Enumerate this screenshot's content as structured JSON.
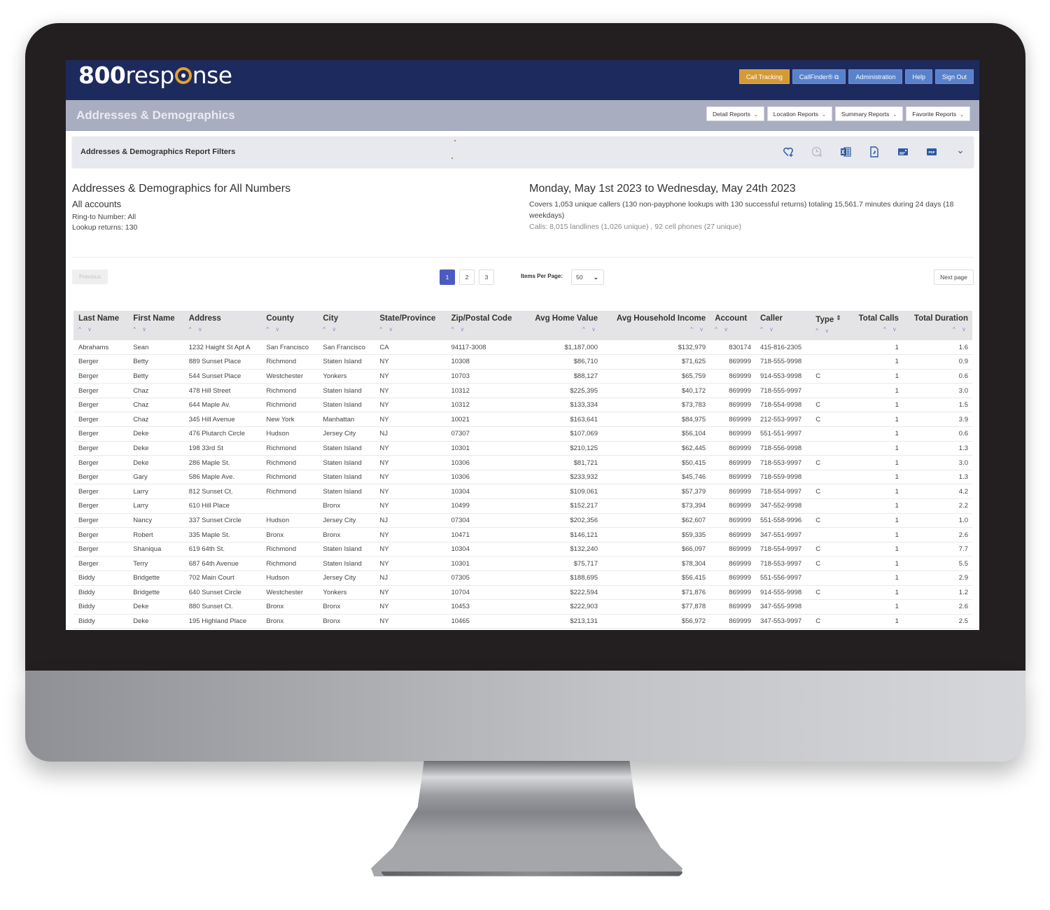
{
  "app": {
    "logo": {
      "bold": "800",
      "light_before": "resp",
      "light_after": "nse"
    },
    "top_nav": [
      {
        "label": "Call Tracking",
        "active": true
      },
      {
        "label": "CallFinder® ⧉",
        "active": false
      },
      {
        "label": "Administration",
        "active": false
      },
      {
        "label": "Help",
        "active": false
      },
      {
        "label": "Sign Out",
        "active": false
      }
    ]
  },
  "subheader": {
    "title": "Addresses & Demographics",
    "menus": [
      "Detail Reports",
      "Location Reports",
      "Summary Reports",
      "Favorite Reports"
    ]
  },
  "filters": {
    "title": "Addresses & Demographics Report Filters",
    "icons": [
      "heart-plus-icon",
      "clock-x-icon",
      "excel-export-icon",
      "csv-export-icon",
      "email-report-icon",
      "pdf-export-icon",
      "chevron-down-icon"
    ]
  },
  "summary": {
    "left": {
      "heading": "Addresses & Demographics for All Numbers",
      "accounts": "All accounts",
      "ring_to": "Ring-to Number: All",
      "lookup": "Lookup returns: 130"
    },
    "right": {
      "date_range": "Monday, May 1st 2023 to Wednesday, May 24th 2023",
      "coverage": "Covers 1,053 unique callers (130 non-payphone lookups with 130 successful returns) totaling 15,561.7 minutes during 24 days (18 weekdays)",
      "calls": "Calls: 8,015 landlines (1,026 unique) , 92 cell phones (27 unique)"
    }
  },
  "pagination": {
    "previous": "Previous",
    "pages": [
      "1",
      "2",
      "3"
    ],
    "current_page": "1",
    "items_per_page_label": "Items Per Page:",
    "items_per_page": "50",
    "next": "Next page"
  },
  "table": {
    "columns": [
      {
        "label": "Last Name",
        "align": "left"
      },
      {
        "label": "First Name",
        "align": "left"
      },
      {
        "label": "Address",
        "align": "left"
      },
      {
        "label": "County",
        "align": "left"
      },
      {
        "label": "City",
        "align": "left"
      },
      {
        "label": "State/Province",
        "align": "left"
      },
      {
        "label": "Zip/Postal Code",
        "align": "left"
      },
      {
        "label": "Avg Home Value",
        "align": "right"
      },
      {
        "label": "Avg Household Income",
        "align": "right"
      },
      {
        "label": "Account",
        "align": "left"
      },
      {
        "label": "Caller",
        "align": "left"
      },
      {
        "label": "Type",
        "align": "left"
      },
      {
        "label": "Total Calls",
        "align": "right"
      },
      {
        "label": "Total Duration",
        "align": "right"
      }
    ],
    "sort_glyph": "^ v",
    "type_sort_glyph": "⇕",
    "rows": [
      [
        "Abrahams",
        "Sean",
        "1232 Haight St Apt A",
        "San Francisco",
        "San Francisco",
        "CA",
        "94117-3008",
        "$1,187,000",
        "$132,979",
        "830174",
        "415-816-2305",
        "",
        "1",
        "1.6"
      ],
      [
        "Berger",
        "Betty",
        "889 Sunset Place",
        "Richmond",
        "Staten Island",
        "NY",
        "10308",
        "$86,710",
        "$71,625",
        "869999",
        "718-555-9998",
        "",
        "1",
        "0.9"
      ],
      [
        "Berger",
        "Betty",
        "544 Sunset Place",
        "Westchester",
        "Yonkers",
        "NY",
        "10703",
        "$88,127",
        "$65,759",
        "869999",
        "914-553-9998",
        "C",
        "1",
        "0.6"
      ],
      [
        "Berger",
        "Chaz",
        "478 Hill Street",
        "Richmond",
        "Staten Island",
        "NY",
        "10312",
        "$225,395",
        "$40,172",
        "869999",
        "718-555-9997",
        "",
        "1",
        "3.0"
      ],
      [
        "Berger",
        "Chaz",
        "644 Maple Av.",
        "Richmond",
        "Staten Island",
        "NY",
        "10312",
        "$133,334",
        "$73,783",
        "869999",
        "718-554-9998",
        "C",
        "1",
        "1.5"
      ],
      [
        "Berger",
        "Chaz",
        "345 Hill Avenue",
        "New York",
        "Manhattan",
        "NY",
        "10021",
        "$163,641",
        "$84,975",
        "869999",
        "212-553-9997",
        "C",
        "1",
        "3.9"
      ],
      [
        "Berger",
        "Deke",
        "476 Plutarch Circle",
        "Hudson",
        "Jersey City",
        "NJ",
        "07307",
        "$107,069",
        "$56,104",
        "869999",
        "551-551-9997",
        "",
        "1",
        "0.6"
      ],
      [
        "Berger",
        "Deke",
        "198 33rd St",
        "Richmond",
        "Staten Island",
        "NY",
        "10301",
        "$210,125",
        "$62,445",
        "869999",
        "718-556-9998",
        "",
        "1",
        "1.3"
      ],
      [
        "Berger",
        "Deke",
        "286 Maple St.",
        "Richmond",
        "Staten Island",
        "NY",
        "10306",
        "$81,721",
        "$50,415",
        "869999",
        "718-553-9997",
        "C",
        "1",
        "3.0"
      ],
      [
        "Berger",
        "Gary",
        "586 Maple Ave.",
        "Richmond",
        "Staten Island",
        "NY",
        "10306",
        "$233,932",
        "$45,746",
        "869999",
        "718-559-9998",
        "",
        "1",
        "1.3"
      ],
      [
        "Berger",
        "Larry",
        "812 Sunset Ct.",
        "Richmond",
        "Staten Island",
        "NY",
        "10304",
        "$109,061",
        "$57,379",
        "869999",
        "718-554-9997",
        "C",
        "1",
        "4.2"
      ],
      [
        "Berger",
        "Larry",
        "610 Hill Place",
        "",
        "Bronx",
        "NY",
        "10499",
        "$152,217",
        "$73,394",
        "869999",
        "347-552-9998",
        "",
        "1",
        "2.2"
      ],
      [
        "Berger",
        "Nancy",
        "337 Sunset Circle",
        "Hudson",
        "Jersey City",
        "NJ",
        "07304",
        "$202,356",
        "$62,607",
        "869999",
        "551-558-9996",
        "C",
        "1",
        "1.0"
      ],
      [
        "Berger",
        "Robert",
        "335 Maple St.",
        "Bronx",
        "Bronx",
        "NY",
        "10471",
        "$146,121",
        "$59,335",
        "869999",
        "347-551-9997",
        "",
        "1",
        "2.6"
      ],
      [
        "Berger",
        "Shaniqua",
        "619 64th St.",
        "Richmond",
        "Staten Island",
        "NY",
        "10304",
        "$132,240",
        "$66,097",
        "869999",
        "718-554-9997",
        "C",
        "1",
        "7.7"
      ],
      [
        "Berger",
        "Terry",
        "687 64th Avenue",
        "Richmond",
        "Staten Island",
        "NY",
        "10301",
        "$75,717",
        "$78,304",
        "869999",
        "718-553-9997",
        "C",
        "1",
        "5.5"
      ],
      [
        "Biddy",
        "Bridgette",
        "702 Main Court",
        "Hudson",
        "Jersey City",
        "NJ",
        "07305",
        "$188,695",
        "$56,415",
        "869999",
        "551-556-9997",
        "",
        "1",
        "2.9"
      ],
      [
        "Biddy",
        "Bridgette",
        "640 Sunset Circle",
        "Westchester",
        "Yonkers",
        "NY",
        "10704",
        "$222,594",
        "$71,876",
        "869999",
        "914-555-9998",
        "C",
        "1",
        "1.2"
      ],
      [
        "Biddy",
        "Deke",
        "880 Sunset Ct.",
        "Bronx",
        "Bronx",
        "NY",
        "10453",
        "$222,903",
        "$77,878",
        "869999",
        "347-555-9998",
        "",
        "1",
        "2.6"
      ],
      [
        "Biddy",
        "Deke",
        "195 Highland Place",
        "Bronx",
        "Bronx",
        "NY",
        "10465",
        "$213,131",
        "$56,972",
        "869999",
        "347-553-9997",
        "C",
        "1",
        "2.5"
      ]
    ]
  },
  "colors": {
    "topbar": "#1d2a5e",
    "subbar": "#a9adc0",
    "accent_gold": "#d49a35",
    "nav_blue": "#5a82cc",
    "page_active": "#4b5bbf"
  }
}
